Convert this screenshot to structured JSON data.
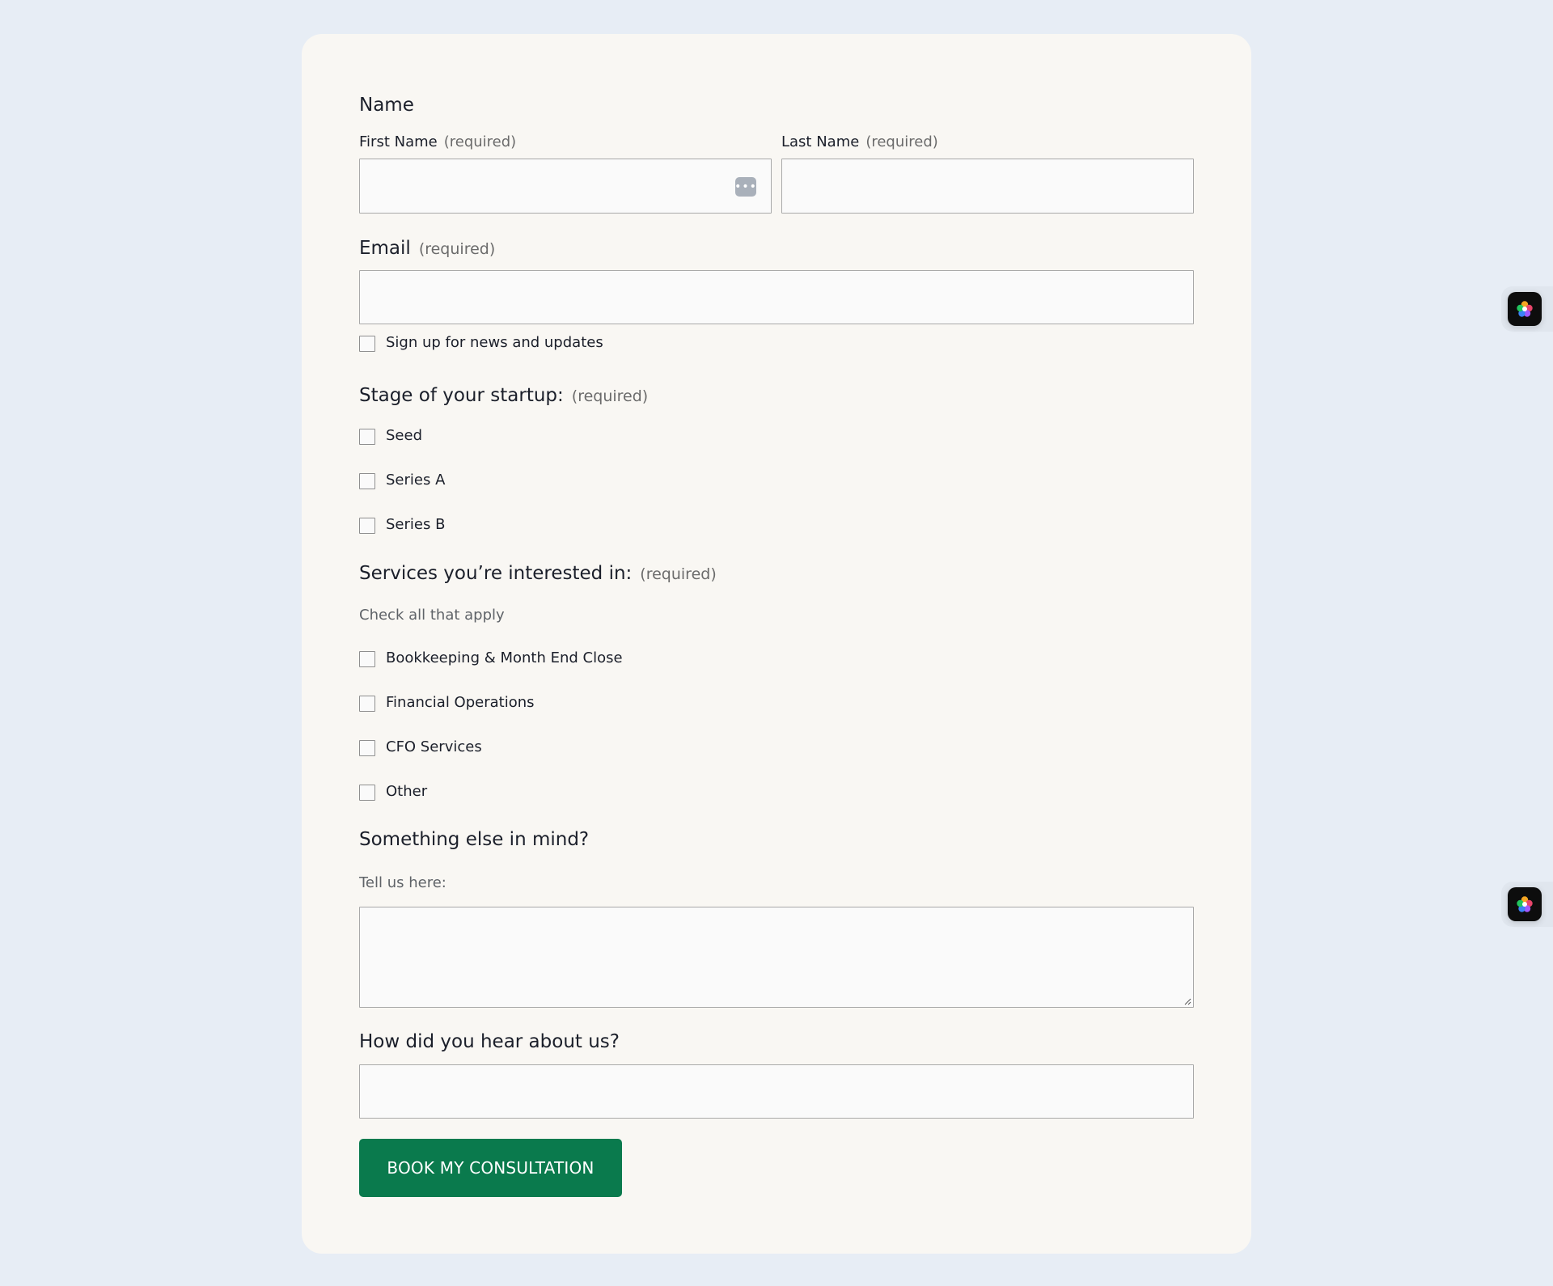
{
  "form": {
    "name_heading": "Name",
    "first_name": {
      "label": "First Name",
      "required": "(required)",
      "value": ""
    },
    "last_name": {
      "label": "Last Name",
      "required": "(required)",
      "value": ""
    },
    "email": {
      "label": "Email",
      "required": "(required)",
      "value": ""
    },
    "newsletter": {
      "label": "Sign up for news and updates",
      "checked": false
    },
    "stage": {
      "label": "Stage of your startup:",
      "required": "(required)",
      "options": [
        "Seed",
        "Series A",
        "Series B"
      ]
    },
    "services": {
      "label": "Services you’re interested in:",
      "required": "(required)",
      "description": "Check all that apply",
      "options": [
        "Bookkeeping & Month End Close",
        "Financial Operations",
        "CFO Services",
        "Other"
      ]
    },
    "something_else": {
      "label": "Something else in mind?",
      "description": "Tell us here:",
      "value": ""
    },
    "referral": {
      "label": "How did you hear about us?",
      "value": ""
    },
    "submit_label": "BOOK MY CONSULTATION"
  },
  "icons": {
    "password_manager": "more-dots-icon",
    "floating_widget": "flower-app-icon"
  },
  "colors": {
    "page_bg": "#e7edf5",
    "card_bg": "#f9f7f3",
    "button_bg": "#0a7a4d",
    "button_text": "#ffffff"
  }
}
